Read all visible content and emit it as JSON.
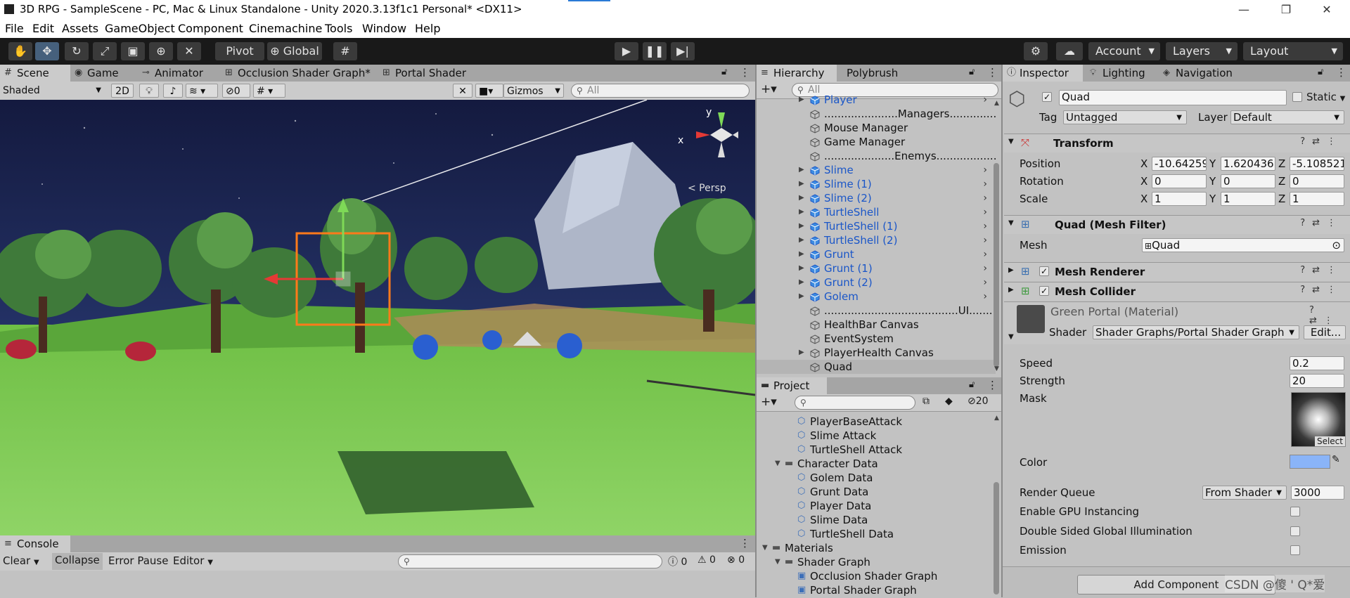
{
  "title_bar": {
    "title": "3D RPG - SampleScene - PC, Mac & Linux Standalone - Unity 2020.3.13f1c1 Personal* <DX11>",
    "minimize": "—",
    "maximize": "❐",
    "close": "✕"
  },
  "menu": [
    "File",
    "Edit",
    "Assets",
    "GameObject",
    "Component",
    "Cinemachine",
    "Tools",
    "Window",
    "Help"
  ],
  "toolbar": {
    "pivot": "Pivot",
    "global": "Global",
    "account": "Account",
    "layers": "Layers",
    "layout": "Layout"
  },
  "scene_panel": {
    "tabs": [
      "Scene",
      "Game",
      "Animator",
      "Occlusion Shader Graph*",
      "Portal Shader Graph"
    ],
    "shading": "Shaded",
    "mode_2d": "2D",
    "hidden_count": "0",
    "gizmos": "Gizmos",
    "search_placeholder": "All",
    "persp_label": "< Persp",
    "axis_x": "x",
    "axis_y": "y"
  },
  "hierarchy": {
    "tabs": [
      "Hierarchy",
      "Polybrush"
    ],
    "search_placeholder": "All",
    "items": [
      {
        "label": "Player",
        "prefab": true,
        "expandable": true
      },
      {
        "label": "......................Managers......................",
        "prefab": false,
        "expandable": false
      },
      {
        "label": "Mouse Manager",
        "prefab": false,
        "expandable": false
      },
      {
        "label": "Game Manager",
        "prefab": false,
        "expandable": false
      },
      {
        "label": ".....................Enemys......................",
        "prefab": false,
        "expandable": false
      },
      {
        "label": "Slime",
        "prefab": true,
        "expandable": true
      },
      {
        "label": "Slime (1)",
        "prefab": true,
        "expandable": true
      },
      {
        "label": "Slime (2)",
        "prefab": true,
        "expandable": true
      },
      {
        "label": "TurtleShell",
        "prefab": true,
        "expandable": true
      },
      {
        "label": "TurtleShell (1)",
        "prefab": true,
        "expandable": true
      },
      {
        "label": "TurtleShell (2)",
        "prefab": true,
        "expandable": true
      },
      {
        "label": "Grunt",
        "prefab": true,
        "expandable": true
      },
      {
        "label": "Grunt (1)",
        "prefab": true,
        "expandable": true
      },
      {
        "label": "Grunt (2)",
        "prefab": true,
        "expandable": true
      },
      {
        "label": "Golem",
        "prefab": true,
        "expandable": true
      },
      {
        "label": "........................................UI......................",
        "prefab": false,
        "expandable": false
      },
      {
        "label": "HealthBar Canvas",
        "prefab": false,
        "expandable": false
      },
      {
        "label": "EventSystem",
        "prefab": false,
        "expandable": false
      },
      {
        "label": "PlayerHealth Canvas",
        "prefab": false,
        "expandable": true
      },
      {
        "label": "Quad",
        "prefab": false,
        "expandable": false,
        "selected": true
      }
    ]
  },
  "project": {
    "tab": "Project",
    "hidden_count": "20",
    "items": [
      {
        "label": "PlayerBaseAttack",
        "indent": 2,
        "type": "asset"
      },
      {
        "label": "Slime Attack",
        "indent": 2,
        "type": "asset"
      },
      {
        "label": "TurtleShell Attack",
        "indent": 2,
        "type": "asset"
      },
      {
        "label": "Character Data",
        "indent": 1,
        "type": "folder"
      },
      {
        "label": "Golem Data",
        "indent": 2,
        "type": "asset"
      },
      {
        "label": "Grunt Data",
        "indent": 2,
        "type": "asset"
      },
      {
        "label": "Player Data",
        "indent": 2,
        "type": "asset"
      },
      {
        "label": "Slime Data",
        "indent": 2,
        "type": "asset"
      },
      {
        "label": "TurtleShell Data",
        "indent": 2,
        "type": "asset"
      },
      {
        "label": "Materials",
        "indent": 0,
        "type": "folder"
      },
      {
        "label": "Shader Graph",
        "indent": 1,
        "type": "folder"
      },
      {
        "label": "Occlusion Shader Graph",
        "indent": 2,
        "type": "shader"
      },
      {
        "label": "Portal Shader Graph",
        "indent": 2,
        "type": "shader"
      }
    ]
  },
  "inspector": {
    "tabs": [
      "Inspector",
      "Lighting",
      "Navigation"
    ],
    "object_name": "Quad",
    "static_label": "Static",
    "tag_label": "Tag",
    "tag_value": "Untagged",
    "layer_label": "Layer",
    "layer_value": "Default",
    "transform": {
      "title": "Transform",
      "position_label": "Position",
      "rotation_label": "Rotation",
      "scale_label": "Scale",
      "position": {
        "x": "-10.64259",
        "y": "1.620436",
        "z": "-5.108521"
      },
      "rotation": {
        "x": "0",
        "y": "0",
        "z": "0"
      },
      "scale": {
        "x": "1",
        "y": "1",
        "z": "1"
      },
      "axis_x": "X",
      "axis_y": "Y",
      "axis_z": "Z"
    },
    "mesh_filter": {
      "title": "Quad (Mesh Filter)",
      "mesh_label": "Mesh",
      "mesh_value": "Quad"
    },
    "mesh_renderer": {
      "title": "Mesh Renderer"
    },
    "mesh_collider": {
      "title": "Mesh Collider"
    },
    "material": {
      "title": "Green Portal (Material)",
      "shader_label": "Shader",
      "shader_value": "Shader Graphs/Portal Shader Graph",
      "edit_label": "Edit...",
      "speed_label": "Speed",
      "speed_value": "0.2",
      "strength_label": "Strength",
      "strength_value": "20",
      "mask_label": "Mask",
      "mask_select": "Select",
      "color_label": "Color",
      "color_value": "#8ab4f8",
      "render_queue_label": "Render Queue",
      "render_queue_mode": "From Shader",
      "render_queue_value": "3000",
      "gpu_instancing_label": "Enable GPU Instancing",
      "double_sided_gi_label": "Double Sided Global Illumination",
      "emission_label": "Emission"
    },
    "add_component": "Add Component"
  },
  "console": {
    "tab": "Console",
    "clear": "Clear",
    "collapse": "Collapse",
    "error_pause": "Error Pause",
    "editor": "Editor",
    "log_count": "0",
    "warn_count": "0",
    "error_count": "0"
  },
  "watermark": "CSDN @傻 ' Q*爱",
  "colors": {
    "prefab_blue": "#1a56c8",
    "toolbar_bg": "#191919",
    "panel_bg": "#c2c2c2",
    "sky": "#1e2a55",
    "grass": "#7cc94e"
  }
}
